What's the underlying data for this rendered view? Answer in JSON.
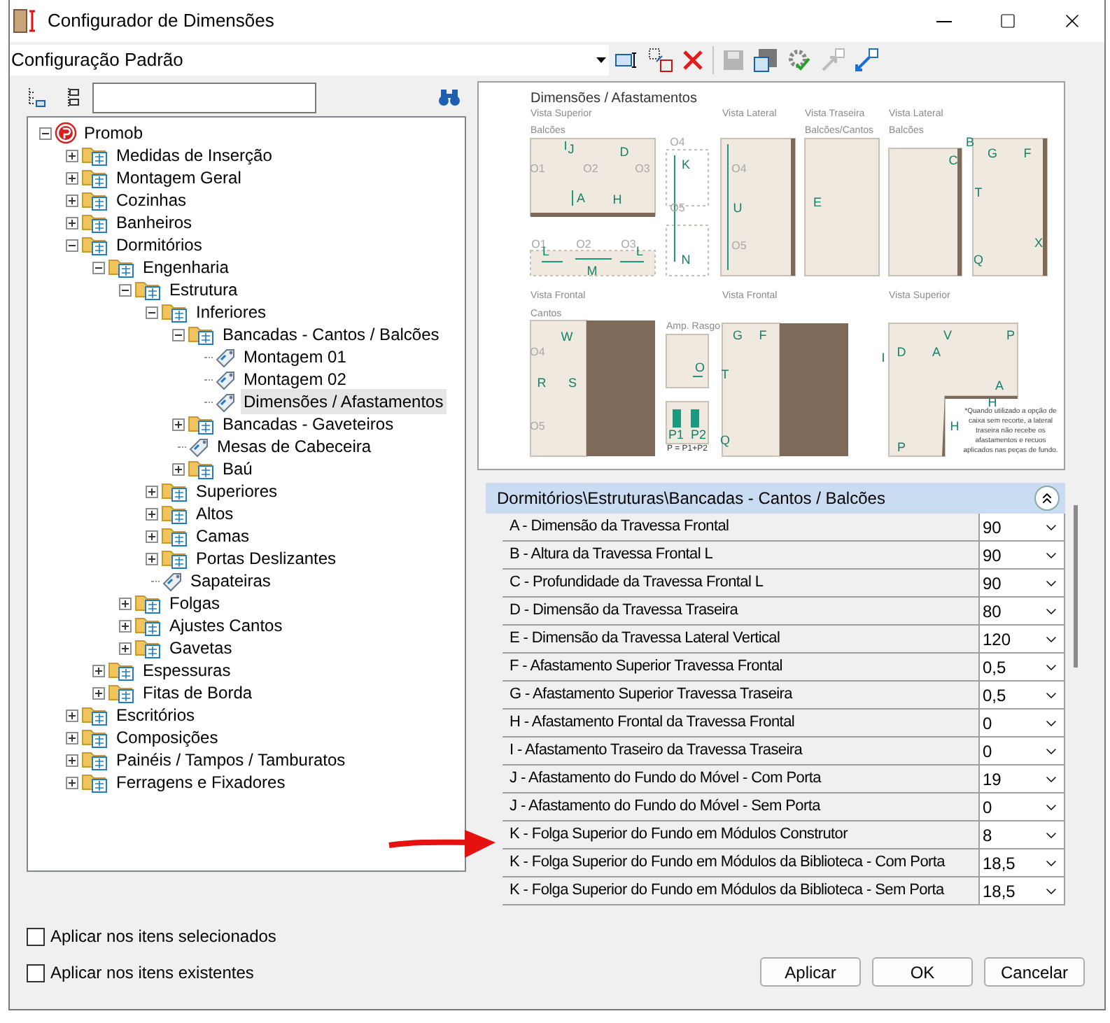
{
  "window": {
    "title": "Configurador de Dimensões"
  },
  "configuration": {
    "value": "Configuração Padrão"
  },
  "tree": [
    {
      "label": "Promob",
      "kind": "root",
      "expanded": true,
      "selected": false,
      "children": [
        {
          "label": "Medidas de Inserção",
          "kind": "folder",
          "expanded": false,
          "selected": false
        },
        {
          "label": "Montagem Geral",
          "kind": "folder",
          "expanded": false,
          "selected": false
        },
        {
          "label": "Cozinhas",
          "kind": "folder",
          "expanded": false,
          "selected": false
        },
        {
          "label": "Banheiros",
          "kind": "folder",
          "expanded": false,
          "selected": false
        },
        {
          "label": "Dormitórios",
          "kind": "folder",
          "expanded": true,
          "selected": false,
          "children": [
            {
              "label": "Engenharia",
              "kind": "folder",
              "expanded": true,
              "selected": false,
              "children": [
                {
                  "label": "Estrutura",
                  "kind": "folder",
                  "expanded": true,
                  "selected": false,
                  "children": [
                    {
                      "label": "Inferiores",
                      "kind": "folder",
                      "expanded": true,
                      "selected": false,
                      "children": [
                        {
                          "label": "Bancadas - Cantos / Balcões",
                          "kind": "folder",
                          "expanded": true,
                          "selected": false,
                          "children": [
                            {
                              "label": "Montagem 01",
                              "kind": "tag",
                              "selected": false
                            },
                            {
                              "label": "Montagem 02",
                              "kind": "tag",
                              "selected": false
                            },
                            {
                              "label": "Dimensões / Afastamentos",
                              "kind": "tag",
                              "selected": true
                            }
                          ]
                        },
                        {
                          "label": "Bancadas - Gaveteiros",
                          "kind": "folder",
                          "expanded": false,
                          "selected": false
                        },
                        {
                          "label": "Mesas de Cabeceira",
                          "kind": "tag",
                          "selected": false
                        },
                        {
                          "label": "Baú",
                          "kind": "folder",
                          "expanded": false,
                          "selected": false
                        }
                      ]
                    },
                    {
                      "label": "Superiores",
                      "kind": "folder",
                      "expanded": false,
                      "selected": false
                    },
                    {
                      "label": "Altos",
                      "kind": "folder",
                      "expanded": false,
                      "selected": false
                    },
                    {
                      "label": "Camas",
                      "kind": "folder",
                      "expanded": false,
                      "selected": false
                    },
                    {
                      "label": "Portas Deslizantes",
                      "kind": "folder",
                      "expanded": false,
                      "selected": false
                    },
                    {
                      "label": "Sapateiras",
                      "kind": "tag",
                      "selected": false
                    }
                  ]
                },
                {
                  "label": "Folgas",
                  "kind": "folder",
                  "expanded": false,
                  "selected": false
                },
                {
                  "label": "Ajustes Cantos",
                  "kind": "folder",
                  "expanded": false,
                  "selected": false
                },
                {
                  "label": "Gavetas",
                  "kind": "folder",
                  "expanded": false,
                  "selected": false
                }
              ]
            },
            {
              "label": "Espessuras",
              "kind": "folder",
              "expanded": false,
              "selected": false
            },
            {
              "label": "Fitas de Borda",
              "kind": "folder",
              "expanded": false,
              "selected": false
            }
          ]
        },
        {
          "label": "Escritórios",
          "kind": "folder",
          "expanded": false,
          "selected": false
        },
        {
          "label": "Composições",
          "kind": "folder",
          "expanded": false,
          "selected": false
        },
        {
          "label": "Painéis / Tampos / Tamburatos",
          "kind": "folder",
          "expanded": false,
          "selected": false
        },
        {
          "label": "Ferragens e Fixadores",
          "kind": "folder",
          "expanded": false,
          "selected": false
        }
      ]
    }
  ],
  "drawing": {
    "title": "Dimensões / Afastamentos",
    "captions": [
      "Vista Superior",
      "Vista Lateral",
      "Vista Traseira",
      "Vista Lateral",
      "Balcões",
      "Balcões/Cantos",
      "Balcões",
      "Vista Frontal",
      "Cantos",
      "Vista Frontal",
      "Vista Superior",
      "Amp. Rasgo"
    ],
    "labels": [
      {
        "text": "J",
        "kind": "dim"
      },
      {
        "text": "D",
        "kind": "dim"
      },
      {
        "text": "O1",
        "kind": "zone"
      },
      {
        "text": "O2",
        "kind": "zone"
      },
      {
        "text": "O3",
        "kind": "zone"
      },
      {
        "text": "A",
        "kind": "dim"
      },
      {
        "text": "H",
        "kind": "dim"
      },
      {
        "text": "O4",
        "kind": "zone"
      },
      {
        "text": "K",
        "kind": "dim"
      },
      {
        "text": "O5",
        "kind": "zone"
      },
      {
        "text": "N",
        "kind": "dim"
      },
      {
        "text": "O1",
        "kind": "zone"
      },
      {
        "text": "O2",
        "kind": "zone"
      },
      {
        "text": "O3",
        "kind": "zone"
      },
      {
        "text": "L",
        "kind": "dim"
      },
      {
        "text": "M",
        "kind": "dim"
      },
      {
        "text": "L",
        "kind": "dim"
      },
      {
        "text": "O4",
        "kind": "zone"
      },
      {
        "text": "U",
        "kind": "dim"
      },
      {
        "text": "O5",
        "kind": "zone"
      },
      {
        "text": "E",
        "kind": "dim"
      },
      {
        "text": "B",
        "kind": "dim"
      },
      {
        "text": "C",
        "kind": "dim"
      },
      {
        "text": "G",
        "kind": "dim"
      },
      {
        "text": "F",
        "kind": "dim"
      },
      {
        "text": "T",
        "kind": "dim"
      },
      {
        "text": "X",
        "kind": "dim"
      },
      {
        "text": "Q",
        "kind": "dim"
      },
      {
        "text": "W",
        "kind": "dim"
      },
      {
        "text": "O4",
        "kind": "zone"
      },
      {
        "text": "R",
        "kind": "dim"
      },
      {
        "text": "S",
        "kind": "dim"
      },
      {
        "text": "O5",
        "kind": "zone"
      },
      {
        "text": "O",
        "kind": "dim"
      },
      {
        "text": "P1",
        "kind": "dim"
      },
      {
        "text": "P2",
        "kind": "dim"
      },
      {
        "text": "P = P1+P2",
        "kind": "note"
      },
      {
        "text": "G",
        "kind": "dim"
      },
      {
        "text": "F",
        "kind": "dim"
      },
      {
        "text": "T",
        "kind": "dim"
      },
      {
        "text": "Q",
        "kind": "dim"
      },
      {
        "text": "V",
        "kind": "dim"
      },
      {
        "text": "P",
        "kind": "dim"
      },
      {
        "text": "I",
        "kind": "dim"
      },
      {
        "text": "D",
        "kind": "dim"
      },
      {
        "text": "A",
        "kind": "dim"
      },
      {
        "text": "A",
        "kind": "dim"
      },
      {
        "text": "H",
        "kind": "dim"
      },
      {
        "text": "H",
        "kind": "dim"
      },
      {
        "text": "P",
        "kind": "dim"
      }
    ],
    "footnote": "*Quando utilizado a opção de caixa sem recorte, a lateral traseira não recebe os afastamentos e recuos aplicados nas peças de fundo."
  },
  "properties": {
    "header": "Dormitórios\\Estruturas\\Bancadas - Cantos / Balcões",
    "expanded": true,
    "rows": [
      {
        "label": "A - Dimensão da Travessa Frontal",
        "value": "90"
      },
      {
        "label": "B - Altura da Travessa Frontal L",
        "value": "90"
      },
      {
        "label": "C - Profundidade da Travessa Frontal L",
        "value": "90"
      },
      {
        "label": "D - Dimensão da Travessa Traseira",
        "value": "80"
      },
      {
        "label": "E - Dimensão da Travessa Lateral Vertical",
        "value": "120"
      },
      {
        "label": "F - Afastamento Superior Travessa Frontal",
        "value": "0,5"
      },
      {
        "label": "G - Afastamento Superior Travessa Traseira",
        "value": "0,5"
      },
      {
        "label": "H - Afastamento Frontal da Travessa Frontal",
        "value": "0"
      },
      {
        "label": "I - Afastamento Traseiro da Travessa Traseira",
        "value": "0"
      },
      {
        "label": "J - Afastamento do Fundo do Móvel - Com Porta",
        "value": "19"
      },
      {
        "label": "J - Afastamento do Fundo do Móvel - Sem Porta",
        "value": "0"
      },
      {
        "label": "K - Folga Superior do Fundo em Módulos Construtor",
        "value": "8"
      },
      {
        "label": "K - Folga Superior do Fundo em Módulos da Biblioteca - Com Porta",
        "value": "18,5"
      },
      {
        "label": "K - Folga Superior do Fundo em Módulos da Biblioteca - Sem Porta",
        "value": "18,5"
      }
    ]
  },
  "options": [
    {
      "label": "Aplicar nos itens selecionados",
      "checked": false
    },
    {
      "label": "Aplicar nos itens existentes",
      "checked": false
    }
  ],
  "buttons": [
    "Aplicar",
    "OK",
    "Cancelar"
  ]
}
